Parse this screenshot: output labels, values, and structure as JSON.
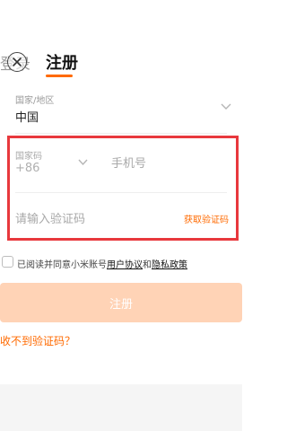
{
  "header": {
    "login_tab": "登录",
    "register_tab": "注册"
  },
  "region": {
    "label": "国家/地区",
    "value": "中国"
  },
  "phone": {
    "country_code_label": "国家码",
    "country_code_value": "+86",
    "phone_placeholder": "手机号",
    "code_placeholder": "请输入验证码",
    "get_code": "获取验证码"
  },
  "agreement": {
    "prefix": "已阅读并同意小米账号",
    "user_agreement": "用户协议",
    "and": "和",
    "privacy_policy": "隐私政策"
  },
  "actions": {
    "register_button": "注册",
    "no_code_link": "收不到验证码？"
  },
  "colors": {
    "accent": "#ff6a00",
    "highlight": "#e8383d",
    "button_disabled": "#ffd3b6"
  }
}
